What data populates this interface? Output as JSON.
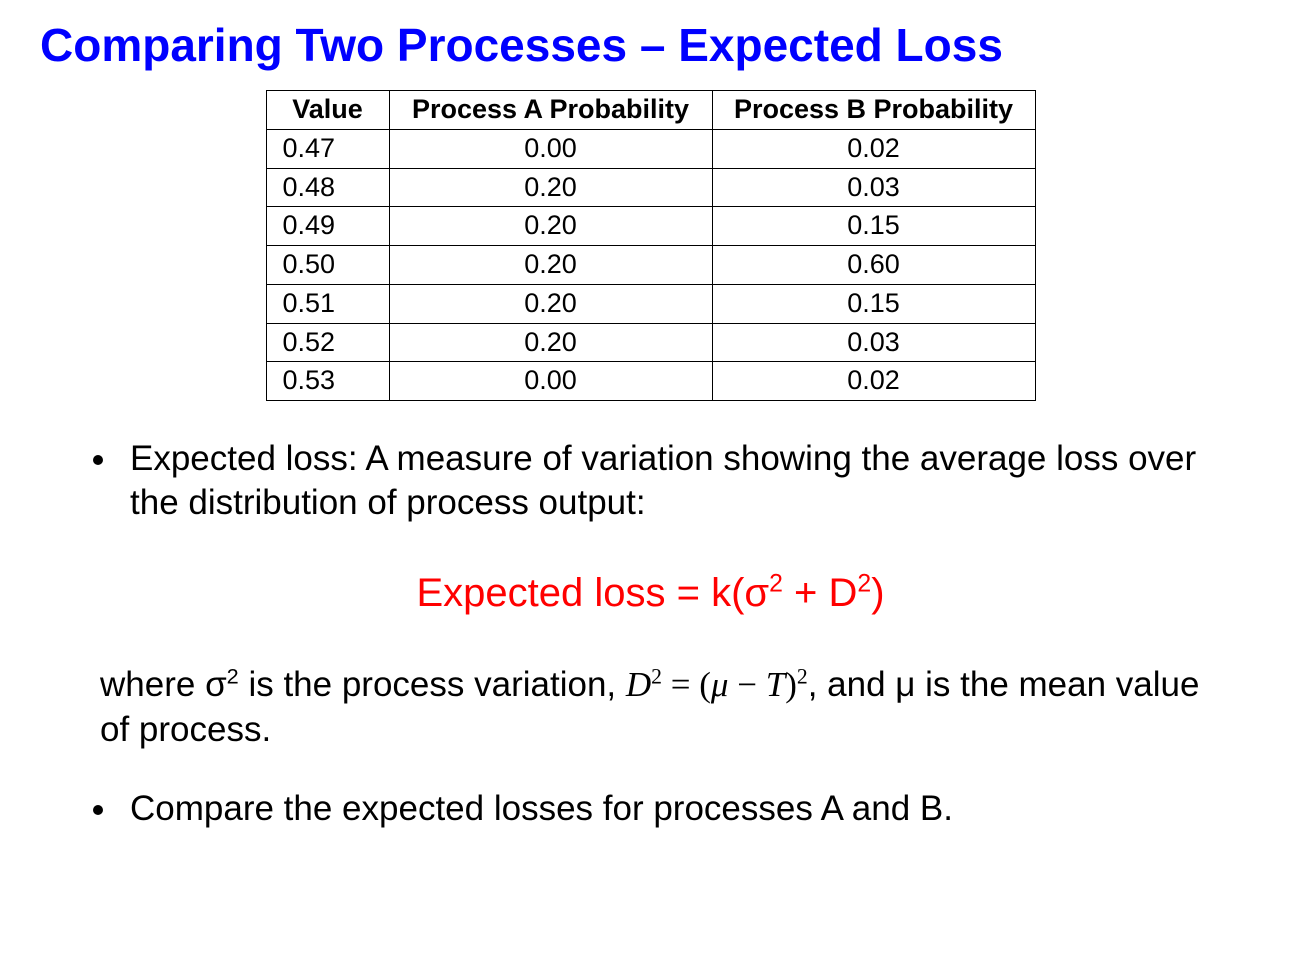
{
  "title": "Comparing Two Processes – Expected Loss",
  "table": {
    "headers": {
      "value": "Value",
      "a": "Process A Probability",
      "b": "Process B Probability"
    },
    "rows": [
      {
        "value": "0.47",
        "a": "0.00",
        "b": "0.02"
      },
      {
        "value": "0.48",
        "a": "0.20",
        "b": "0.03"
      },
      {
        "value": "0.49",
        "a": "0.20",
        "b": "0.15"
      },
      {
        "value": "0.50",
        "a": "0.20",
        "b": "0.60"
      },
      {
        "value": "0.51",
        "a": "0.20",
        "b": "0.15"
      },
      {
        "value": "0.52",
        "a": "0.20",
        "b": "0.03"
      },
      {
        "value": "0.53",
        "a": "0.00",
        "b": "0.02"
      }
    ]
  },
  "bullet1": "Expected loss: A measure of variation showing the average loss over the distribution of process output:",
  "formula": {
    "lhs": "Expected loss = k(",
    "sigma": "σ",
    "sup2a": "2",
    "plus": " + D",
    "sup2b": "2",
    "rparen": ")"
  },
  "explain": {
    "p1": " where ",
    "sigma": "σ",
    "sup2": "2",
    "p2": " is the process variation,  ",
    "d": "D",
    "d_sup": "2",
    "eq": " = (",
    "mu_it": "μ",
    "minus": " − ",
    "t_it": "T",
    "rp": ")",
    "rp_sup": "2",
    "p3": ", and μ is the mean value of process."
  },
  "bullet2": "Compare the expected losses for processes A and B.",
  "chart_data": {
    "type": "table",
    "title": "Comparing Two Processes – Expected Loss",
    "columns": [
      "Value",
      "Process A Probability",
      "Process B Probability"
    ],
    "rows": [
      [
        0.47,
        0.0,
        0.02
      ],
      [
        0.48,
        0.2,
        0.03
      ],
      [
        0.49,
        0.2,
        0.15
      ],
      [
        0.5,
        0.2,
        0.6
      ],
      [
        0.51,
        0.2,
        0.15
      ],
      [
        0.52,
        0.2,
        0.03
      ],
      [
        0.53,
        0.0,
        0.02
      ]
    ]
  }
}
